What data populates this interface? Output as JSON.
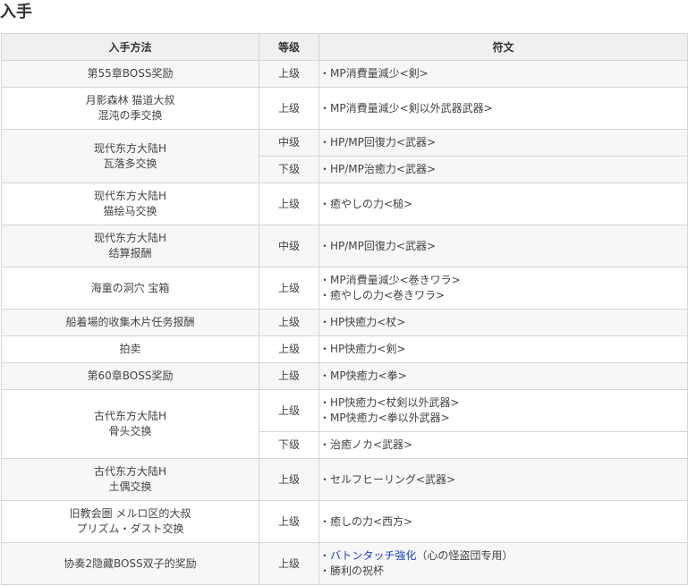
{
  "section": {
    "title": "入手"
  },
  "table": {
    "headers": {
      "method": "入手方法",
      "grade": "等级",
      "rune": "符文"
    },
    "row1": {
      "method": [
        "第55章BOSS奖励"
      ],
      "grade": "上级",
      "rune": [
        "・MP消費量減少<剣>"
      ]
    },
    "row2": {
      "method": [
        "月影森林 猫道大叔",
        "混沌の季交换"
      ],
      "grade": "上级",
      "rune": [
        "・MP消費量減少<剣以外武器武器>"
      ]
    },
    "row3": {
      "method": [
        "现代东方大陆H",
        "瓦落多交换"
      ],
      "grade": "中级",
      "rune": [
        "・HP/MP回復力<武器>"
      ]
    },
    "row3b": {
      "grade": "下级",
      "rune": [
        "・HP/MP治癒力<武器>"
      ]
    },
    "row4": {
      "method": [
        "现代东方大陆H",
        "猫绘马交换"
      ],
      "grade": "上级",
      "rune": [
        "・癒やしの力<槌>"
      ]
    },
    "row5": {
      "method": [
        "现代东方大陆H",
        "结算报酬"
      ],
      "grade": "中级",
      "rune": [
        "・HP/MP回復力<武器>"
      ]
    },
    "row6": {
      "method": [
        "海童の洞穴 宝箱"
      ],
      "grade": "上级",
      "rune": [
        "・MP消費量減少<巻きワラ>",
        "・癒やしの力<巻きワラ>"
      ]
    },
    "row7": {
      "method": [
        "船着場的收集木片任务报酬"
      ],
      "grade": "上级",
      "rune": [
        "・HP快癒力<杖>"
      ]
    },
    "row8": {
      "method": [
        "拍卖"
      ],
      "grade": "上级",
      "rune": [
        "・HP快癒力<剣>"
      ]
    },
    "row9": {
      "method": [
        "第60章BOSS奖励"
      ],
      "grade": "上级",
      "rune": [
        "・MP快癒力<拳>"
      ]
    },
    "row10": {
      "method": [
        "古代东方大陆H",
        "骨头交换"
      ],
      "grade": "上级",
      "rune": [
        "・HP快癒力<杖剣以外武器>",
        "・MP快癒力<拳以外武器>"
      ]
    },
    "row10b": {
      "grade": "下级",
      "rune": [
        "・治癒ノカ<武器>"
      ]
    },
    "row11": {
      "method": [
        "古代东方大陆H",
        "土偶交换"
      ],
      "grade": "上级",
      "rune": [
        "・セルフヒーリング<武器>"
      ]
    },
    "row12": {
      "method": [
        "旧教会圏 メルロ区的大叔",
        "プリズム・ダスト交换"
      ],
      "grade": "上级",
      "rune": [
        "・癒しの力<西方>"
      ]
    },
    "row13": {
      "method": [
        "协奏2隐藏BOSS双子的奖励"
      ],
      "grade": "上级",
      "rune_bullet": "・",
      "rune_link": "バトンタッチ強化",
      "rune_note": "（心の怪盗団专用）",
      "rune_line2": "・勝利の祝杯"
    }
  },
  "colors": {
    "header_bg": "#f0f0f0",
    "row_shade": "#f7f7f7",
    "border": "#d6d6d6",
    "link": "#1a3cc8"
  }
}
